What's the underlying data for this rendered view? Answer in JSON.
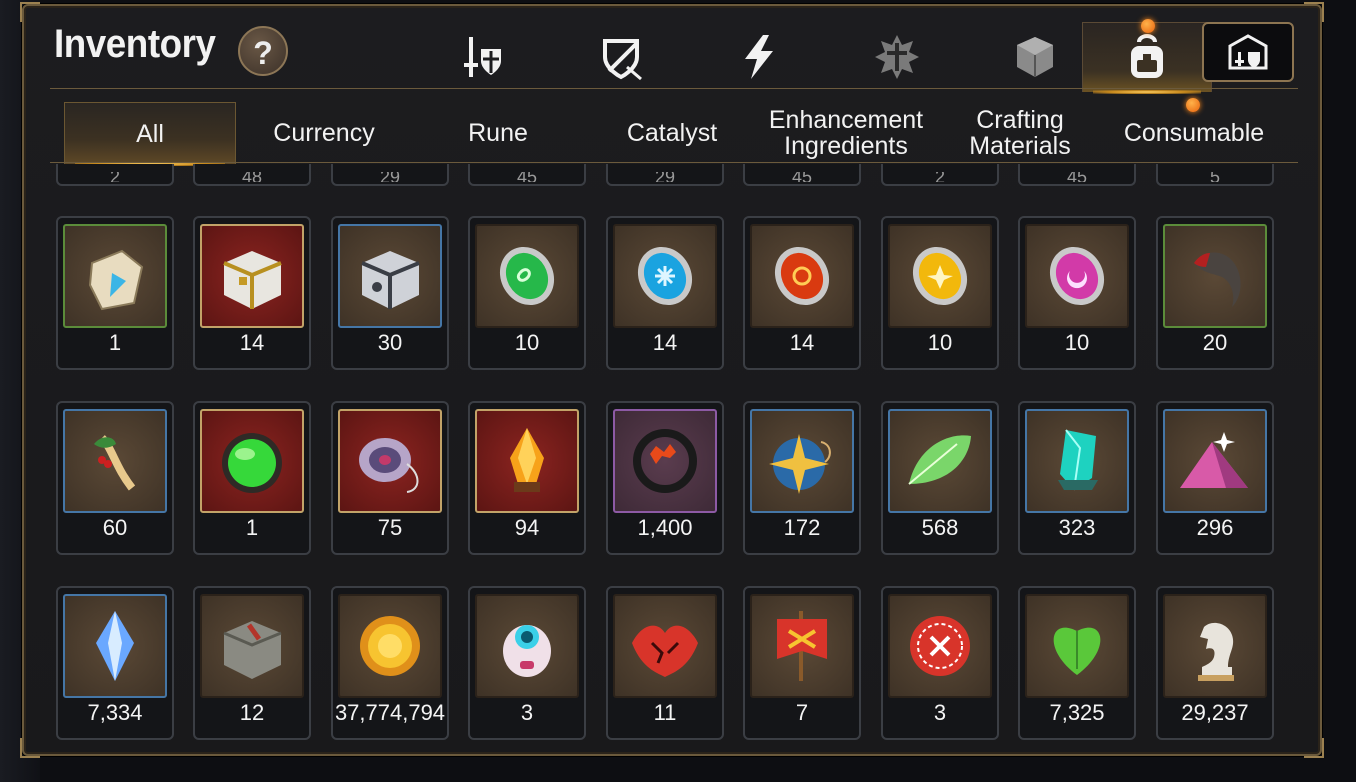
{
  "header": {
    "title": "Inventory",
    "help_label": "?"
  },
  "top_tabs": [
    {
      "name": "gear-icon-tab",
      "icon": "sword-shield-icon"
    },
    {
      "name": "armor-tab",
      "icon": "broken-shield-icon"
    },
    {
      "name": "skill-tab",
      "icon": "lightning-icon"
    },
    {
      "name": "artifact-tab",
      "icon": "splat-cross-icon"
    },
    {
      "name": "cube-tab",
      "icon": "cube-icon"
    },
    {
      "name": "bag-tab",
      "icon": "backpack-icon",
      "active": true
    }
  ],
  "sub_tabs": [
    {
      "label": "All",
      "active": true
    },
    {
      "label": "Currency"
    },
    {
      "label": "Rune"
    },
    {
      "label": "Catalyst"
    },
    {
      "label": "Enhancement\nIngredients"
    },
    {
      "label": "Crafting\nMaterials"
    },
    {
      "label": "Consumable"
    }
  ],
  "partial_row": [
    "2",
    "48",
    "29",
    "45",
    "29",
    "45",
    "2",
    "45",
    "5"
  ],
  "rows": [
    [
      {
        "icon": "rune-stone-icon",
        "rarity": "green",
        "qty": "1"
      },
      {
        "icon": "gold-chest-icon",
        "rarity": "red",
        "qty": "14"
      },
      {
        "icon": "silver-chest-icon",
        "rarity": "blue",
        "qty": "30"
      },
      {
        "icon": "green-rune-icon",
        "rarity": "brown",
        "qty": "10"
      },
      {
        "icon": "blue-rune-icon",
        "rarity": "brown",
        "qty": "14"
      },
      {
        "icon": "red-rune-icon",
        "rarity": "brown",
        "qty": "14"
      },
      {
        "icon": "yellow-rune-icon",
        "rarity": "brown",
        "qty": "10"
      },
      {
        "icon": "purple-rune-icon",
        "rarity": "brown",
        "qty": "10"
      },
      {
        "icon": "claw-icon",
        "rarity": "green",
        "qty": "20"
      }
    ],
    [
      {
        "icon": "ginseng-icon",
        "rarity": "blue",
        "qty": "60"
      },
      {
        "icon": "green-orb-icon",
        "rarity": "red",
        "qty": "1"
      },
      {
        "icon": "yo-yo-icon",
        "rarity": "red",
        "qty": "75"
      },
      {
        "icon": "flame-crystal-icon",
        "rarity": "red",
        "qty": "94"
      },
      {
        "icon": "flame-ring-icon",
        "rarity": "purple",
        "qty": "1,400"
      },
      {
        "icon": "star-pendant-icon",
        "rarity": "blue",
        "qty": "172"
      },
      {
        "icon": "leaf-icon",
        "rarity": "blue",
        "qty": "568"
      },
      {
        "icon": "teal-crystal-icon",
        "rarity": "blue",
        "qty": "323"
      },
      {
        "icon": "pink-powder-icon",
        "rarity": "blue",
        "qty": "296"
      }
    ],
    [
      {
        "icon": "blue-gem-icon",
        "rarity": "blue",
        "qty": "7,334"
      },
      {
        "icon": "stone-block-icon",
        "rarity": "brown",
        "qty": "12"
      },
      {
        "icon": "gold-coin-icon",
        "rarity": "brown",
        "qty": "37,774,794"
      },
      {
        "icon": "robot-egg-icon",
        "rarity": "brown",
        "qty": "3"
      },
      {
        "icon": "red-leaf-icon",
        "rarity": "brown",
        "qty": "11"
      },
      {
        "icon": "banner-icon",
        "rarity": "brown",
        "qty": "7"
      },
      {
        "icon": "red-seal-icon",
        "rarity": "brown",
        "qty": "3"
      },
      {
        "icon": "green-heart-icon",
        "rarity": "brown",
        "qty": "7,325"
      },
      {
        "icon": "chess-knight-icon",
        "rarity": "brown",
        "qty": "29,237"
      }
    ]
  ]
}
